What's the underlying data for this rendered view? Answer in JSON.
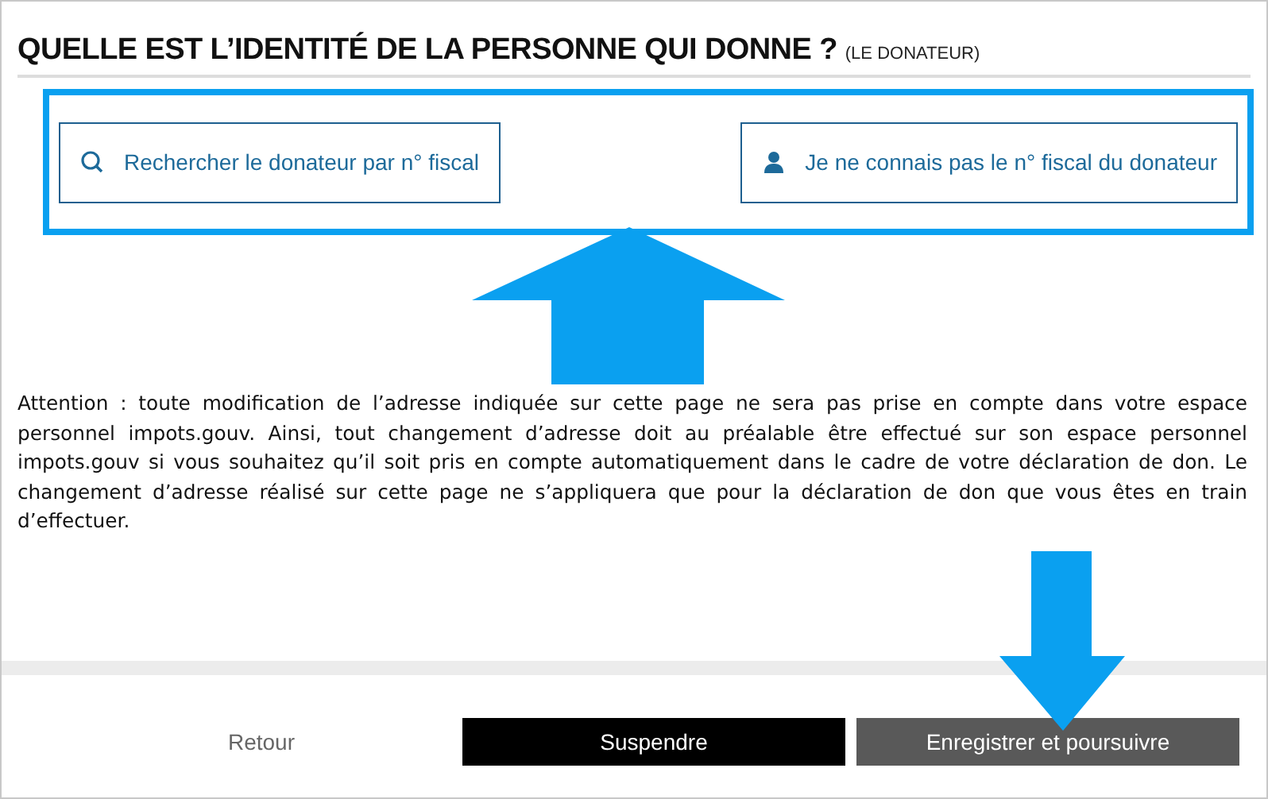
{
  "heading": {
    "title": "QUELLE EST L’IDENTITÉ DE LA PERSONNE QUI DONNE ?",
    "subtitle": "(LE DONATEUR)"
  },
  "options": [
    {
      "kind": "search",
      "label": "Rechercher le donateur par n° fiscal"
    },
    {
      "kind": "person",
      "label": "Je ne connais pas le n° fiscal du donateur"
    }
  ],
  "notice": "Attention : toute modification de l’adresse indiquée sur cette page ne sera pas prise en compte dans votre espace personnel impots.gouv. Ainsi, tout changement d’adresse doit au préalable être effectué sur son espace personnel impots.gouv si vous souhaitez qu’il soit pris en compte automatiquement dans le cadre de votre déclaration de don. Le changement d’adresse réalisé sur cette page ne s’appliquera que pour la déclaration de don que vous êtes en train d’effectuer.",
  "footer": [
    {
      "kind": "link",
      "label": "Retour"
    },
    {
      "kind": "dark",
      "label": "Suspendre"
    },
    {
      "kind": "grey",
      "label": "Enregistrer et poursuivre"
    }
  ]
}
